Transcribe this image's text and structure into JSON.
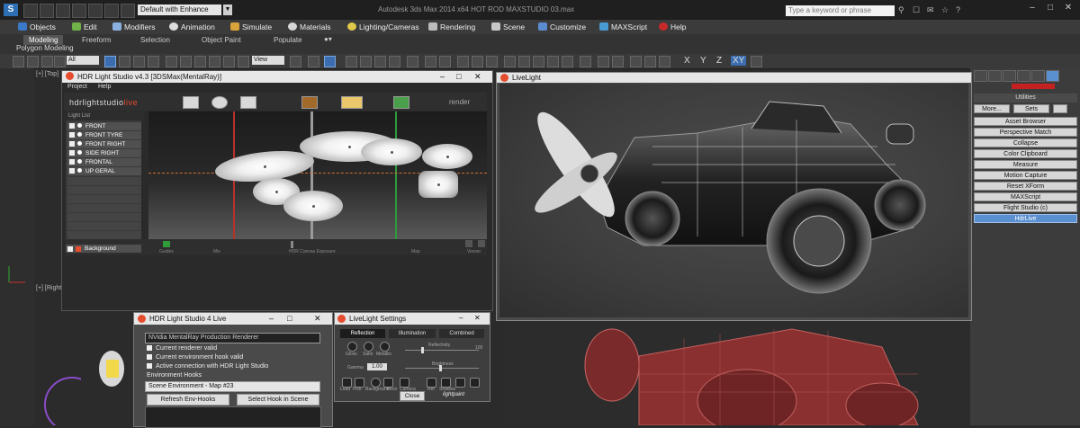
{
  "app": {
    "workspace": "Default with Enhance",
    "window_title": "Autodesk 3ds Max 2014 x64     HOT ROD MAXSTUDIO 03.max",
    "search_placeholder": "Type a keyword or phrase"
  },
  "menu": [
    "Objects",
    "Edit",
    "Modifiers",
    "Animation",
    "Simulate",
    "Materials",
    "Lighting/Cameras",
    "Rendering",
    "Scene",
    "Customize",
    "MAXScript",
    "Help"
  ],
  "ribbon": {
    "tabs": [
      "Modeling",
      "Freeform",
      "Selection",
      "Object Paint",
      "Populate"
    ],
    "active_tab": "Modeling",
    "subtitle": "Polygon Modeling"
  },
  "toolbar": {
    "filter": "All",
    "view": "View",
    "axes": [
      "X",
      "Y",
      "Z",
      "XY"
    ]
  },
  "viewports": {
    "top_label": "[+] [Top]",
    "right_label": "[+] [Right]"
  },
  "command_panel": {
    "header": "Utilities",
    "row1": [
      "More...",
      "Sets"
    ],
    "buttons": [
      "Asset Browser",
      "Perspective Match",
      "Collapse",
      "Color Clipboard",
      "Measure",
      "Motion Capture",
      "Reset XForm",
      "MAXScript",
      "Flight Studio (c)",
      "HdrLive"
    ],
    "selected": "HdrLive"
  },
  "hdr_window": {
    "title": "HDR Light Studio v4.3 [3DSMax(MentalRay)]",
    "menu": [
      "Project",
      "Help"
    ],
    "logo_a": "hdrlightstudio",
    "logo_b": "live",
    "render_label": "render",
    "list_header": "Light List",
    "lights": [
      "FRONT",
      "FRONT TYRE",
      "FRONT RIGHT",
      "SIDE RIGHT",
      "FRONTAL",
      "UP GERAL"
    ],
    "background_label": "Background",
    "slider_labels": [
      "Guides",
      "Mix",
      "HDR Canvas Exposure",
      "Map",
      "Viewer"
    ]
  },
  "livelight": {
    "title": "LiveLight"
  },
  "hdr_live4": {
    "title": "HDR Light Studio 4 Live",
    "renderer": "NVidia MentalRay Production Renderer",
    "checks": [
      "Current renderer valid",
      "Current environment hook valid",
      "Active connection with HDR Light Studio"
    ],
    "hooks_label": "Environment Hooks",
    "hook_value": "Scene Environment - Map #23",
    "btn_refresh": "Refresh Env-Hooks",
    "btn_select": "Select Hook in Scene"
  },
  "livelight_settings": {
    "title": "LiveLight Settings",
    "tabs": [
      "Reflection",
      "Illumination",
      "Combined"
    ],
    "swatches": [
      "Gloss",
      "Satin",
      "Metallic"
    ],
    "reflectivity_label": "Reflectivity",
    "gamma_label": "Gamma",
    "gamma_value": "1.00",
    "brightness_label": "Brightness",
    "bottom_icons": [
      "Load",
      "Pick",
      "Background",
      "Floor",
      "Camera",
      "Ref",
      "Shadow"
    ],
    "close": "Close",
    "brand": "lightpaint",
    "range_max": "100"
  },
  "colors": {
    "accent_blue": "#3b6db0",
    "guide_red": "#b8322a",
    "guide_green": "#2f9b3a",
    "horizon_orange": "#d07030",
    "logo_red": "#e64c2e"
  }
}
